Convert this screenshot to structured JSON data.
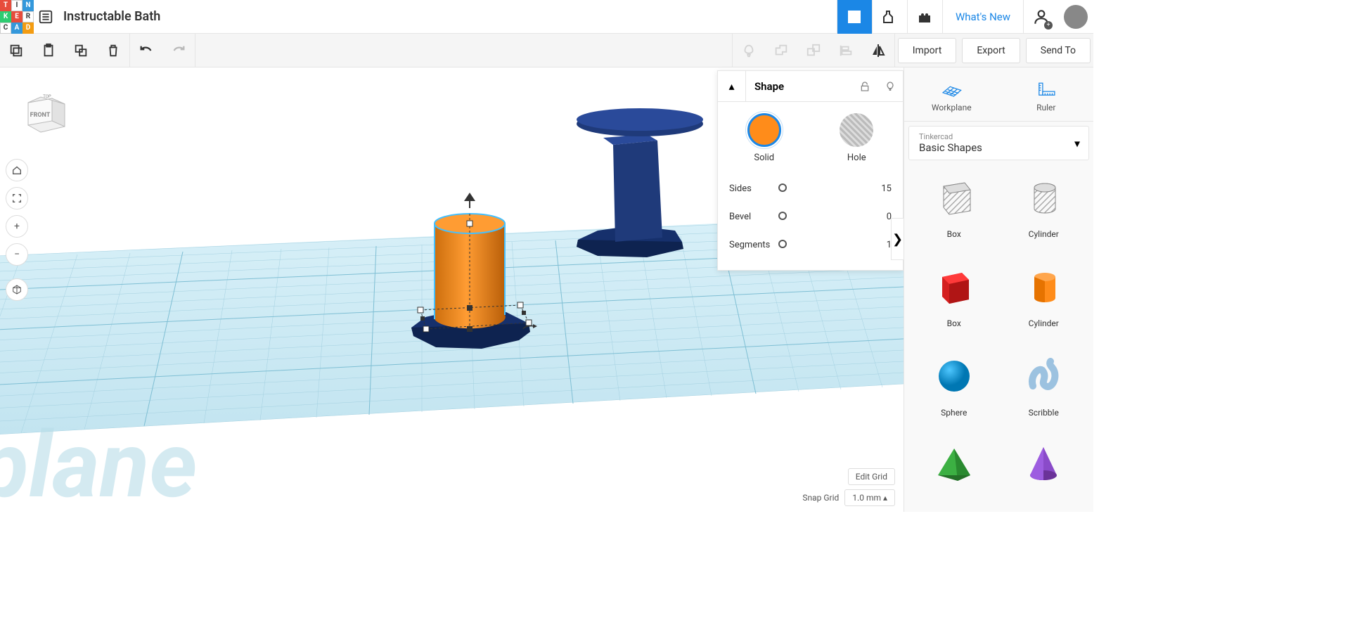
{
  "header": {
    "project_title": "Instructable Bath",
    "whats_new": "What's New"
  },
  "toolbar": {
    "import_label": "Import",
    "export_label": "Export",
    "sendto_label": "Send To"
  },
  "viewcube": {
    "front": "FRONT",
    "top": "TOP"
  },
  "shape_panel": {
    "title": "Shape",
    "solid_label": "Solid",
    "hole_label": "Hole",
    "params": [
      {
        "label": "Sides",
        "value": "15"
      },
      {
        "label": "Bevel",
        "value": "0"
      },
      {
        "label": "Segments",
        "value": "1"
      }
    ]
  },
  "sidebar": {
    "workplane_label": "Workplane",
    "ruler_label": "Ruler",
    "category_sub": "Tinkercad",
    "category_main": "Basic Shapes",
    "shapes": [
      {
        "label": "Box",
        "type": "box-hole"
      },
      {
        "label": "Cylinder",
        "type": "cyl-hole"
      },
      {
        "label": "Box",
        "type": "box-red"
      },
      {
        "label": "Cylinder",
        "type": "cyl-orange"
      },
      {
        "label": "Sphere",
        "type": "sphere"
      },
      {
        "label": "Scribble",
        "type": "scribble"
      },
      {
        "label": "",
        "type": "pyramid"
      },
      {
        "label": "",
        "type": "cone"
      }
    ]
  },
  "bottom": {
    "edit_grid": "Edit Grid",
    "snap_label": "Snap Grid",
    "snap_value": "1.0 mm"
  },
  "colors": {
    "accent": "#1b87e6",
    "orange": "#ff8c1a",
    "navy": "#1f3a7a"
  }
}
